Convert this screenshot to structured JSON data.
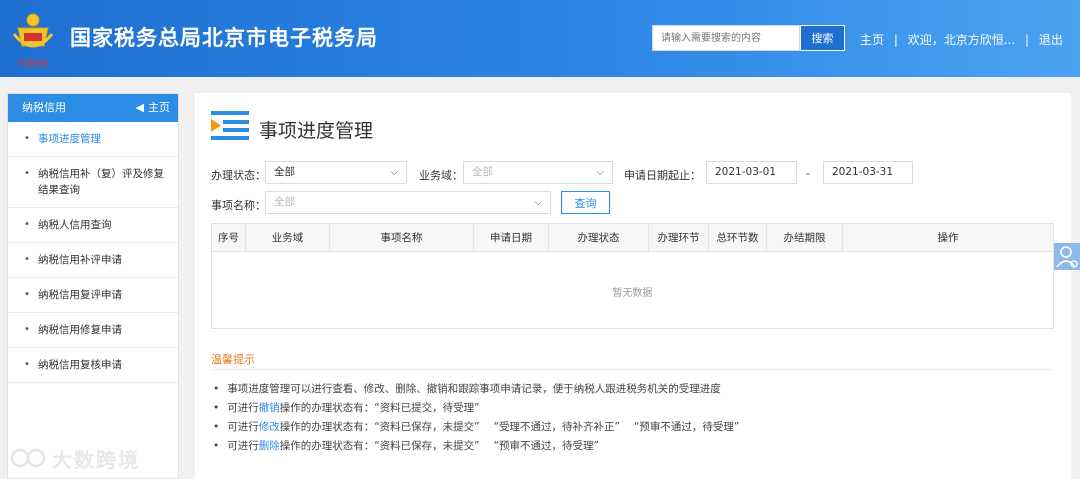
{
  "header": {
    "site_title": "国家税务总局北京市电子税务局",
    "search_placeholder": "请输入需要搜索的内容",
    "search_button": "搜索",
    "nav_home": "主页",
    "nav_welcome": "欢迎，北京方欣恒...",
    "nav_logout": "退出",
    "separator": "|",
    "emblem_text": "中国税务"
  },
  "sidebar": {
    "title": "纳税信用",
    "home_label": "主页",
    "items": [
      {
        "label": "事项进度管理"
      },
      {
        "label": "纳税信用补（复）评及修复结果查询"
      },
      {
        "label": "纳税人信用查询"
      },
      {
        "label": "纳税信用补评申请"
      },
      {
        "label": "纳税信用复评申请"
      },
      {
        "label": "纳税信用修复申请"
      },
      {
        "label": "纳税信用复核申请"
      }
    ]
  },
  "main": {
    "page_title": "事项进度管理",
    "filters": {
      "status_label": "办理状态：",
      "status_value": "全部",
      "domain_label": "业务域：",
      "domain_value": "全部",
      "date_label": "申请日期起止：",
      "date_from": "2021-03-01",
      "date_sep": "-",
      "date_to": "2021-03-31",
      "name_label": "事项名称：",
      "name_value": "全部",
      "query_button": "查询"
    },
    "table": {
      "columns": [
        "序号",
        "业务域",
        "事项名称",
        "申请日期",
        "办理状态",
        "办理环节",
        "总环节数",
        "办结期限",
        "操作"
      ],
      "empty_text": "暂无数据"
    },
    "tips": {
      "title": "温馨提示",
      "line1": "事项进度管理可以进行查看、修改、删除、撤销和跟踪事项申请记录，便于纳税人跟进税务机关的受理进度",
      "line2": {
        "pre": "可进行",
        "op": "撤销",
        "post": "操作的办理状态有：",
        "q1": "“资料已提交，待受理”"
      },
      "line3": {
        "pre": "可进行",
        "op": "修改",
        "post": "操作的办理状态有：",
        "q1": "“资料已保存，未提交”",
        "q2": "“受理不通过，待补齐补正”",
        "q3": "“预审不通过，待受理”"
      },
      "line4": {
        "pre": "可进行",
        "op": "删除",
        "post": "操作的办理状态有：",
        "q1": "“资料已保存，未提交”",
        "q2": "“预审不通过，待受理”"
      }
    }
  },
  "watermark": "大数跨境",
  "colors": {
    "header_blue": "#1e6fd0",
    "accent": "#2b8de6",
    "tip_title": "#e67e22"
  }
}
